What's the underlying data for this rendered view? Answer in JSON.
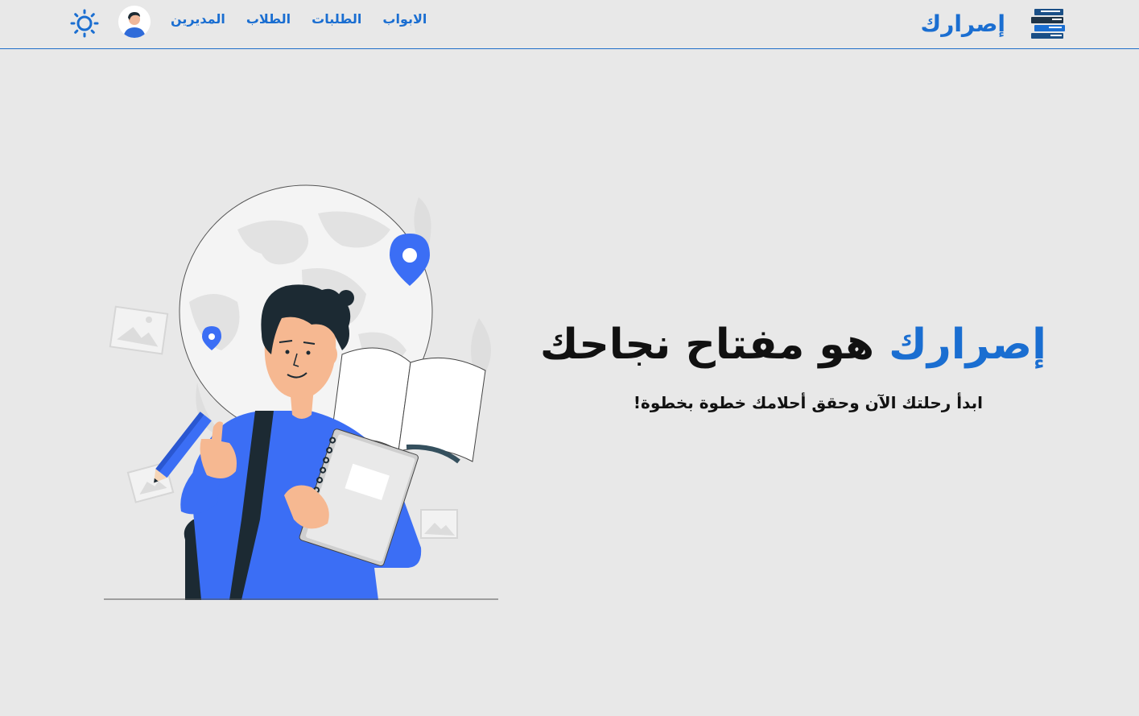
{
  "brand": {
    "name": "إصرارك",
    "logo_icon": "stacked-books-icon"
  },
  "nav": {
    "links": [
      {
        "label": "الابواب"
      },
      {
        "label": "الطلبات"
      },
      {
        "label": "الطلاب"
      },
      {
        "label": "المديرين"
      }
    ]
  },
  "user": {
    "avatar_icon": "user-avatar-icon"
  },
  "theme": {
    "toggle_icon": "sun-icon"
  },
  "hero": {
    "title_accent": "إصرارك",
    "title_rest": "هو مفتاح نجاحك",
    "subtitle": "ابدأ رحلتك الآن وحقق أحلامك خطوة بخطوة!"
  },
  "colors": {
    "accent": "#1a6ed1",
    "illustration_blue": "#3b6ef5",
    "background": "#e8e8e8",
    "text": "#111111"
  }
}
